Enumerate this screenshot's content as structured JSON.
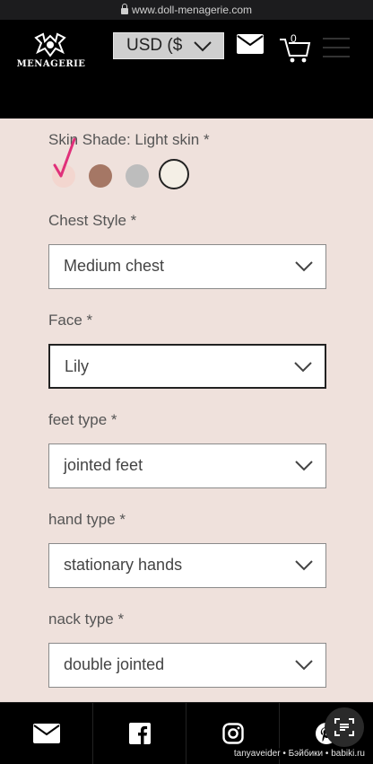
{
  "browser": {
    "url": "www.doll-menagerie.com"
  },
  "header": {
    "logo_text": "MENAGERIE",
    "currency_label": "USD ($",
    "cart_count": "0"
  },
  "options": {
    "skin": {
      "label": "Skin Shade: Light skin *",
      "selected": "Light skin"
    },
    "chest": {
      "label": "Chest Style *",
      "value": "Medium chest"
    },
    "face": {
      "label": "Face *",
      "value": "Lily"
    },
    "feet": {
      "label": "feet type *",
      "value": "jointed feet"
    },
    "hand": {
      "label": "hand type *",
      "value": "stationary hands"
    },
    "neck": {
      "label": "nack type *",
      "value": "double jointed"
    }
  },
  "swatches": [
    {
      "name": "light",
      "color": "#f3d6cf"
    },
    {
      "name": "brown",
      "color": "#a57765"
    },
    {
      "name": "grey",
      "color": "#bdbdbd"
    },
    {
      "name": "white",
      "color": "#f4efe6"
    }
  ],
  "footer": {
    "icons": [
      "mail-icon",
      "facebook-icon",
      "instagram-icon",
      "pinterest-icon"
    ]
  },
  "watermark": "tanyaveider • Бэйбики • babiki.ru"
}
